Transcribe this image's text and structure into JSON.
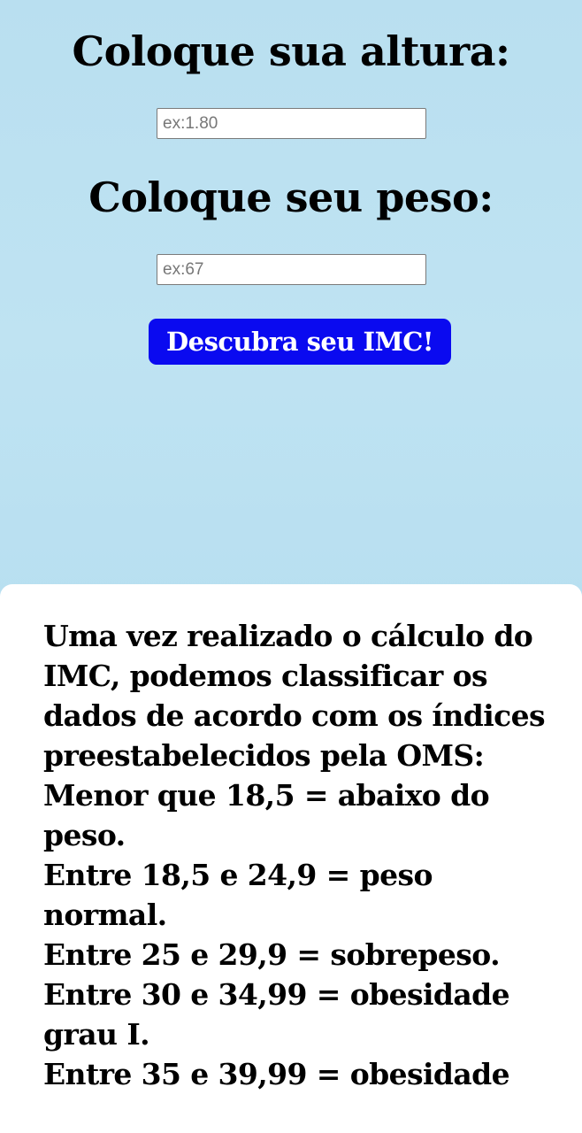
{
  "form": {
    "height_label": "Coloque sua altura:",
    "height_placeholder": "ex:1.80",
    "weight_label": "Coloque seu peso:",
    "weight_placeholder": "ex:67",
    "submit_label": "Descubra seu IMC!"
  },
  "info": {
    "intro": "Uma vez realizado o cálculo do IMC, podemos classificar os dados de acordo com os índices preestabelecidos pela OMS:",
    "ranges": [
      "Menor que 18,5 = abaixo do peso.",
      "Entre 18,5 e 24,9 = peso normal.",
      "Entre 25 e 29,9 = sobrepeso.",
      "Entre 30 e 34,99 = obesidade grau I.",
      "Entre 35 e 39,99 = obesidade"
    ]
  },
  "colors": {
    "background": "#bde2f2",
    "button": "#0a0af0",
    "card": "#ffffff"
  }
}
